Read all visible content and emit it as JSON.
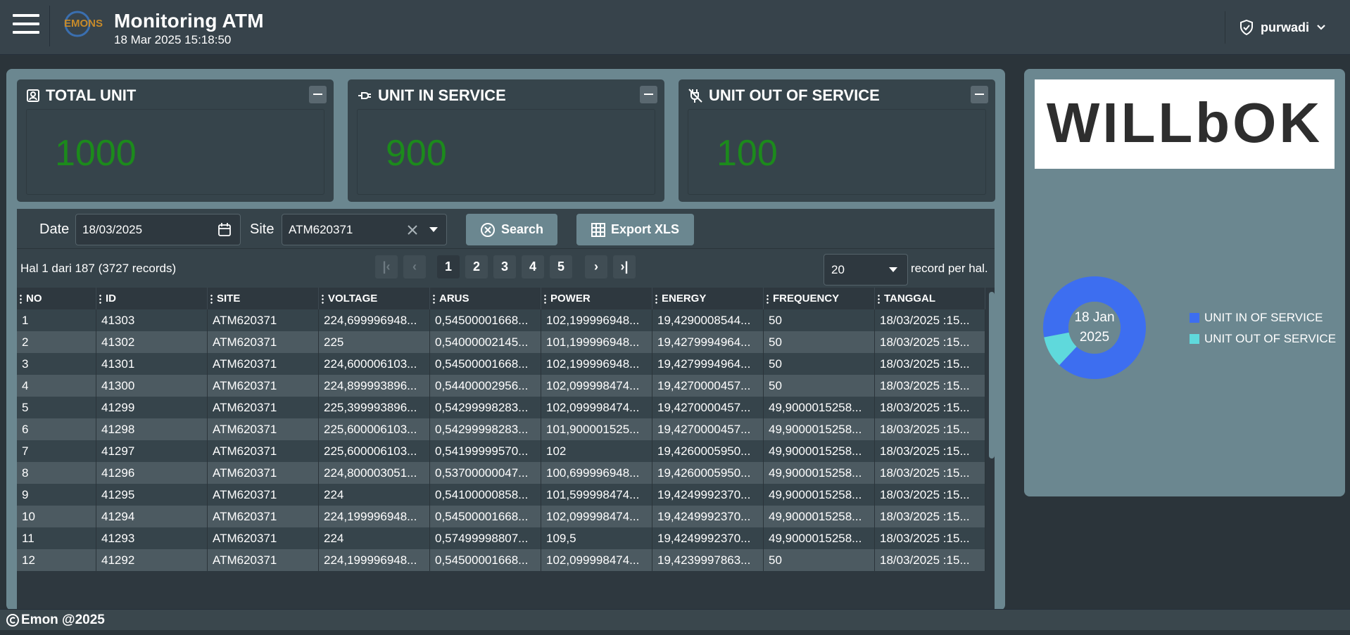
{
  "header": {
    "title": "Monitoring ATM",
    "datetime": "18 Mar 2025 15:18:50",
    "user": "purwadi",
    "logo_text": "EMONS"
  },
  "cards": [
    {
      "title": "TOTAL UNIT",
      "value": "1000",
      "icon": "user-id-icon"
    },
    {
      "title": "UNIT IN SERVICE",
      "value": "900",
      "icon": "plug-icon"
    },
    {
      "title": "UNIT OUT OF SERVICE",
      "value": "100",
      "icon": "plug-off-icon"
    }
  ],
  "filters": {
    "date_label": "Date",
    "date_value": "18/03/2025",
    "site_label": "Site",
    "site_value": "ATM620371",
    "search_label": "Search",
    "export_label": "Export XLS"
  },
  "pager": {
    "info": "Hal 1 dari 187 (3727 records)",
    "pages": [
      "1",
      "2",
      "3",
      "4",
      "5"
    ],
    "page_size": "20",
    "page_size_label": "record per hal."
  },
  "table": {
    "columns": [
      "NO",
      "ID",
      "SITE",
      "VOLTAGE",
      "ARUS",
      "POWER",
      "ENERGY",
      "FREQUENCY",
      "TANGGAL"
    ],
    "rows": [
      [
        "1",
        "41303",
        "ATM620371",
        "224,699996948...",
        "0,54500001668...",
        "102,199996948...",
        "19,4290008544...",
        "50",
        "18/03/2025 :15..."
      ],
      [
        "2",
        "41302",
        "ATM620371",
        "225",
        "0,54000002145...",
        "101,199996948...",
        "19,4279994964...",
        "50",
        "18/03/2025 :15..."
      ],
      [
        "3",
        "41301",
        "ATM620371",
        "224,600006103...",
        "0,54500001668...",
        "102,199996948...",
        "19,4279994964...",
        "50",
        "18/03/2025 :15..."
      ],
      [
        "4",
        "41300",
        "ATM620371",
        "224,899993896...",
        "0,54400002956...",
        "102,099998474...",
        "19,4270000457...",
        "50",
        "18/03/2025 :15..."
      ],
      [
        "5",
        "41299",
        "ATM620371",
        "225,399993896...",
        "0,54299998283...",
        "102,099998474...",
        "19,4270000457...",
        "49,9000015258...",
        "18/03/2025 :15..."
      ],
      [
        "6",
        "41298",
        "ATM620371",
        "225,600006103...",
        "0,54299998283...",
        "101,900001525...",
        "19,4270000457...",
        "49,9000015258...",
        "18/03/2025 :15..."
      ],
      [
        "7",
        "41297",
        "ATM620371",
        "225,600006103...",
        "0,54199999570...",
        "102",
        "19,4260005950...",
        "49,9000015258...",
        "18/03/2025 :15..."
      ],
      [
        "8",
        "41296",
        "ATM620371",
        "224,800003051...",
        "0,53700000047...",
        "100,699996948...",
        "19,4260005950...",
        "49,9000015258...",
        "18/03/2025 :15..."
      ],
      [
        "9",
        "41295",
        "ATM620371",
        "224",
        "0,54100000858...",
        "101,599998474...",
        "19,4249992370...",
        "49,9000015258...",
        "18/03/2025 :15..."
      ],
      [
        "10",
        "41294",
        "ATM620371",
        "224,199996948...",
        "0,54500001668...",
        "102,099998474...",
        "19,4249992370...",
        "49,9000015258...",
        "18/03/2025 :15..."
      ],
      [
        "11",
        "41293",
        "ATM620371",
        "224",
        "0,57499998807...",
        "109,5",
        "19,4249992370...",
        "49,9000015258...",
        "18/03/2025 :15..."
      ],
      [
        "12",
        "41292",
        "ATM620371",
        "224,199996948...",
        "0,54500001668...",
        "102,099998474...",
        "19,4239997863...",
        "50",
        "18/03/2025 :15..."
      ]
    ]
  },
  "footer": {
    "copyright": "Emon @2025"
  },
  "side": {
    "brand_logo_text": "WILLbOK",
    "donut_center_line1": "18 Jan",
    "donut_center_line2": "2025",
    "legend": [
      {
        "label": "UNIT IN OF SERVICE",
        "color": "#3d6ef0"
      },
      {
        "label": "UNIT OUT OF SERVICE",
        "color": "#5fd9dc"
      }
    ]
  },
  "chart_data": {
    "type": "pie",
    "categories": [
      "UNIT IN OF SERVICE",
      "UNIT OUT OF SERVICE"
    ],
    "values": [
      900,
      100
    ],
    "colors": [
      "#3d6ef0",
      "#5fd9dc"
    ],
    "title": "",
    "center_text": "18 Jan 2025",
    "legend_position": "right"
  }
}
